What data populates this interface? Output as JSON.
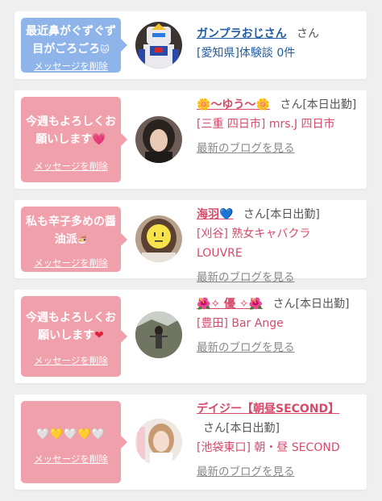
{
  "colors": {
    "bubble_blue": "#8fb4ea",
    "bubble_pink": "#f0a0ab",
    "accent_pink": "#d64a6a",
    "accent_blue": "#1f5ba6"
  },
  "delete_label": "メッセージを削除",
  "blog_label": "最新のブログを見る",
  "san": "さん",
  "cards": [
    {
      "message": "最近鼻がぐずぐず目がごろごろ",
      "message_icon": "🐱",
      "name": "ガンプラおじさん",
      "suffix": "さん",
      "location": "[愛知県]体験談 0件"
    },
    {
      "message": "今週もよろしくお願いします",
      "message_icon": "💗",
      "name_deco_left": "🌼",
      "name": "～ゆう～",
      "name_deco_right": "🌼",
      "suffix": "さん[本日出勤]",
      "location": "[三重 四日市] mrs.J 四日市"
    },
    {
      "message": "私も辛子多めの醤油派",
      "message_icon": "🍜",
      "name": "海羽",
      "name_deco_right": "💙",
      "suffix": "さん[本日出勤]",
      "location": "[刈谷] 熟女キャバクラ LOUVRE"
    },
    {
      "message": "今週もよろしくお願いします",
      "message_icon": "❤",
      "name_deco_left": "🌺✧",
      "name": " 優 ",
      "name_deco_right": "✧🌺",
      "suffix": "さん[本日出勤]",
      "location": "[豊田] Bar Ange"
    },
    {
      "message_hearts": "🤍💛🤍💛🤍",
      "name": "デイジー【朝昼SECOND】",
      "suffix": "さん[本日出勤]",
      "location": "[池袋東口] 朝・昼 SECOND"
    }
  ]
}
